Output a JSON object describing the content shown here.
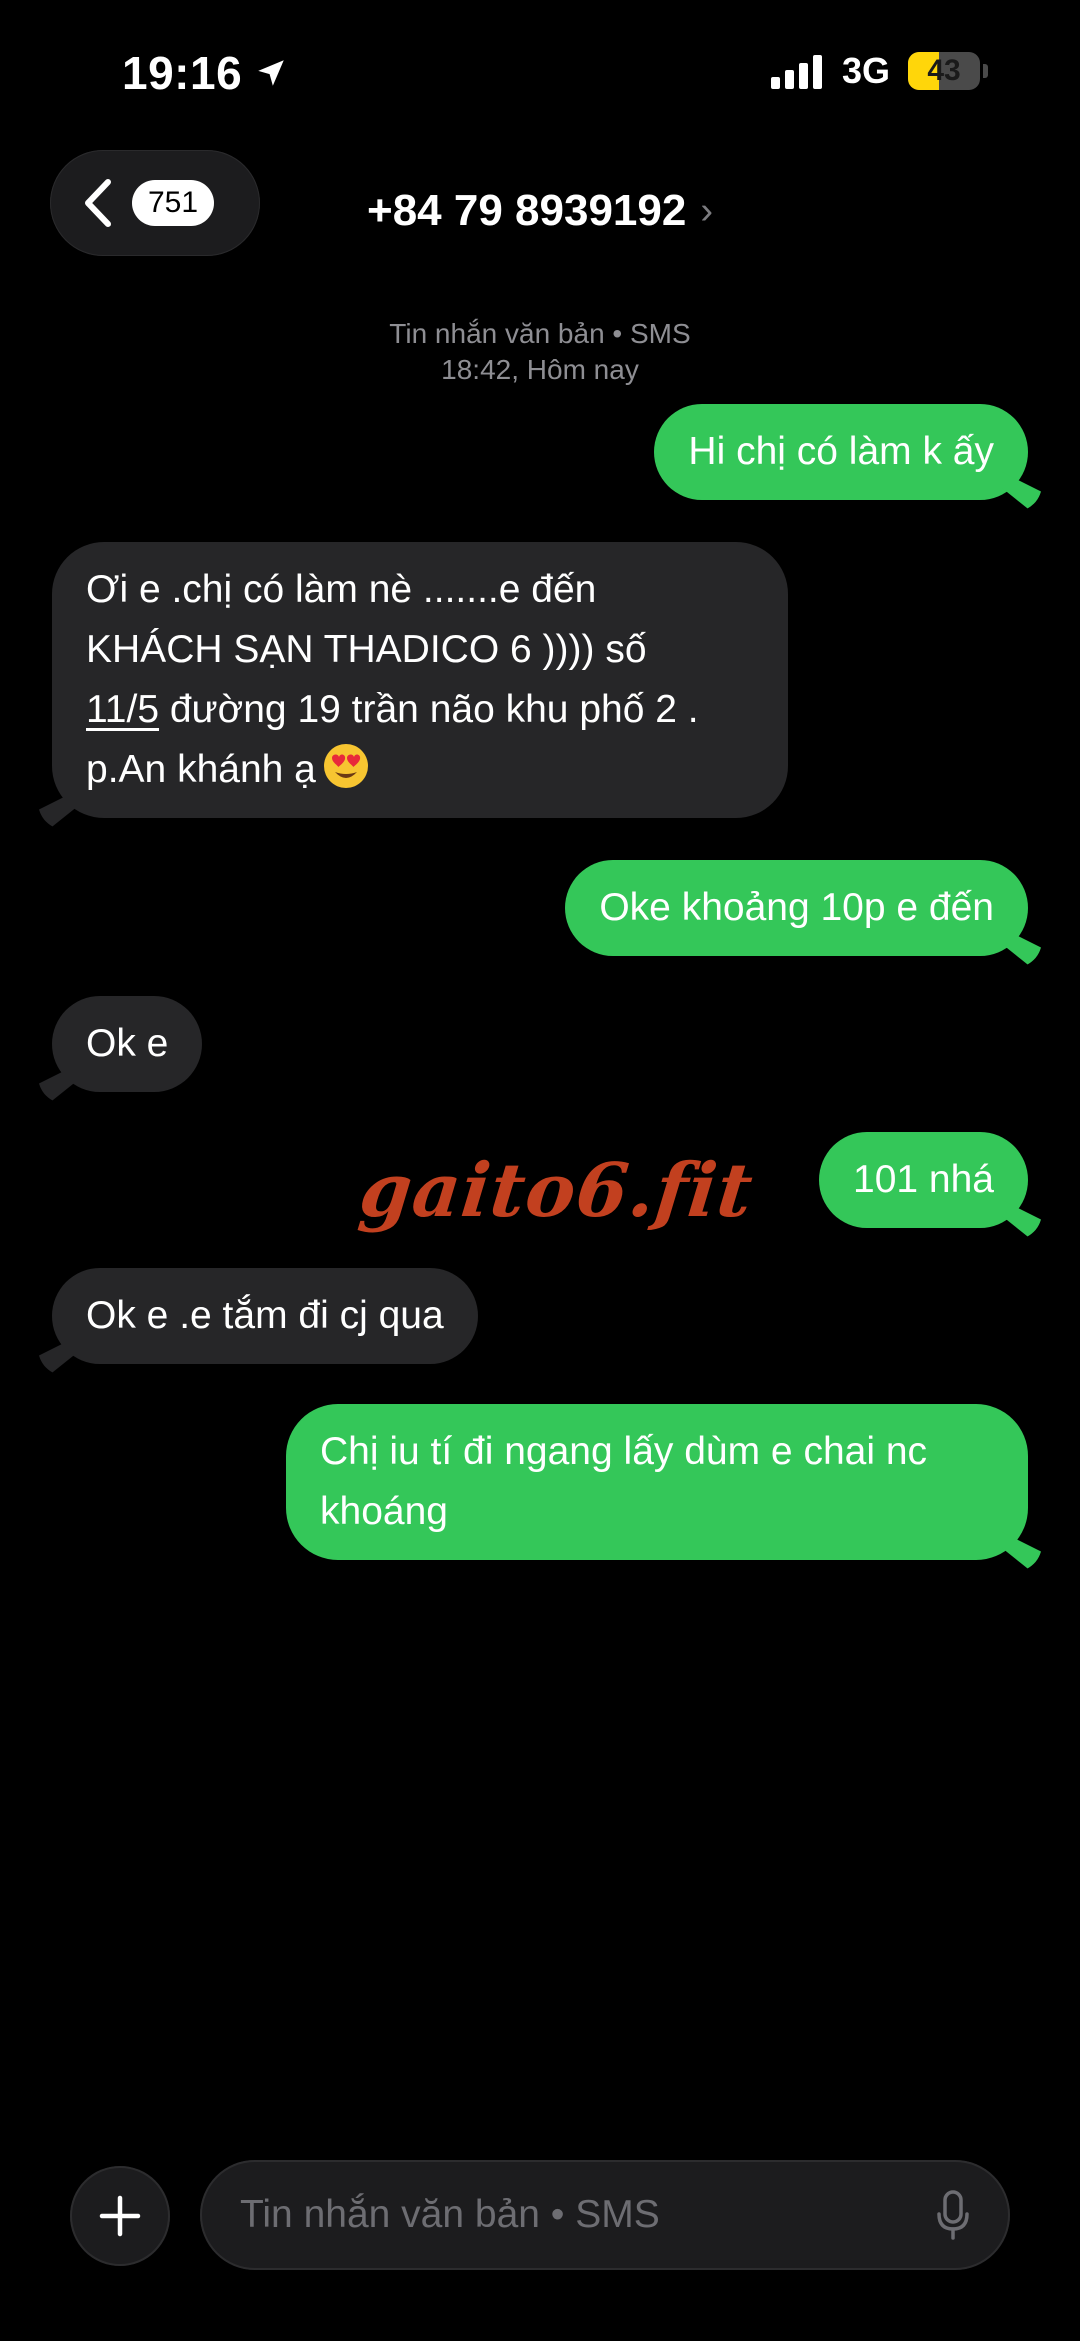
{
  "status_bar": {
    "time": "19:16",
    "network": "3G",
    "battery_level": "43",
    "battery_fraction": 0.43,
    "icons": [
      "location-arrow-icon",
      "signal-bars-icon",
      "battery-icon"
    ]
  },
  "header": {
    "back_badge": "751",
    "contact": "+84 79 8939192",
    "chevron": "›"
  },
  "meta": {
    "service": "Tin nhắn văn bản • SMS",
    "timestamp": "18:42, Hôm nay"
  },
  "messages": [
    {
      "direction": "out",
      "text": "Hi chị có làm k ấy"
    },
    {
      "direction": "in",
      "line1": "Ơi e .chị có làm nè .......e  đến",
      "line2": "KHÁCH SẠN  THADICO 6 ))))    số",
      "line3_link": "11/5",
      "line3_rest": " đường 19 trần não khu phố 2 .",
      "line4": "p.An khánh ạ",
      "emoji": "smiling-face-with-heart-eyes-emoji"
    },
    {
      "direction": "out",
      "text": "Oke khoảng 10p e đến"
    },
    {
      "direction": "in",
      "text": "Ok e"
    },
    {
      "direction": "out",
      "text": "101 nhá"
    },
    {
      "direction": "in",
      "text": "Ok e .e tắm đi cj qua"
    },
    {
      "direction": "out",
      "line1": "Chị iu tí đi ngang lấy dùm e chai nc",
      "line2": "khoáng"
    }
  ],
  "watermark": "gaito6.fit",
  "composer": {
    "placeholder": "Tin nhắn văn bản • SMS",
    "icons": [
      "plus-icon",
      "microphone-icon"
    ]
  },
  "colors": {
    "outgoing_bubble": "#34c759",
    "incoming_bubble": "#262628",
    "battery": "#ffd60a",
    "watermark": "#c2401f"
  }
}
